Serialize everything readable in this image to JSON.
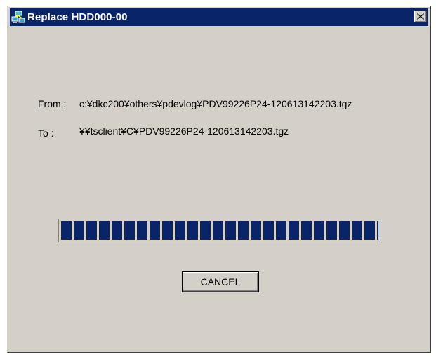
{
  "window": {
    "title": "Replace HDD000-00",
    "app_icon": "network-computers-icon",
    "close_icon": "close-icon"
  },
  "transfer": {
    "from_label": "From :",
    "from_path": "c:¥dkc200¥others¥pdevlog¥PDV99226P24-120613142203.tgz",
    "to_label": "To :",
    "to_path": "¥¥tsclient¥C¥PDV99226P24-120613142203.tgz"
  },
  "progress": {
    "fraction": 1.0
  },
  "buttons": {
    "cancel_label": "CANCEL"
  },
  "colors": {
    "title_bar": "#0a246a",
    "window_face": "#d4d0c8",
    "progress_block": "#0a246a"
  }
}
